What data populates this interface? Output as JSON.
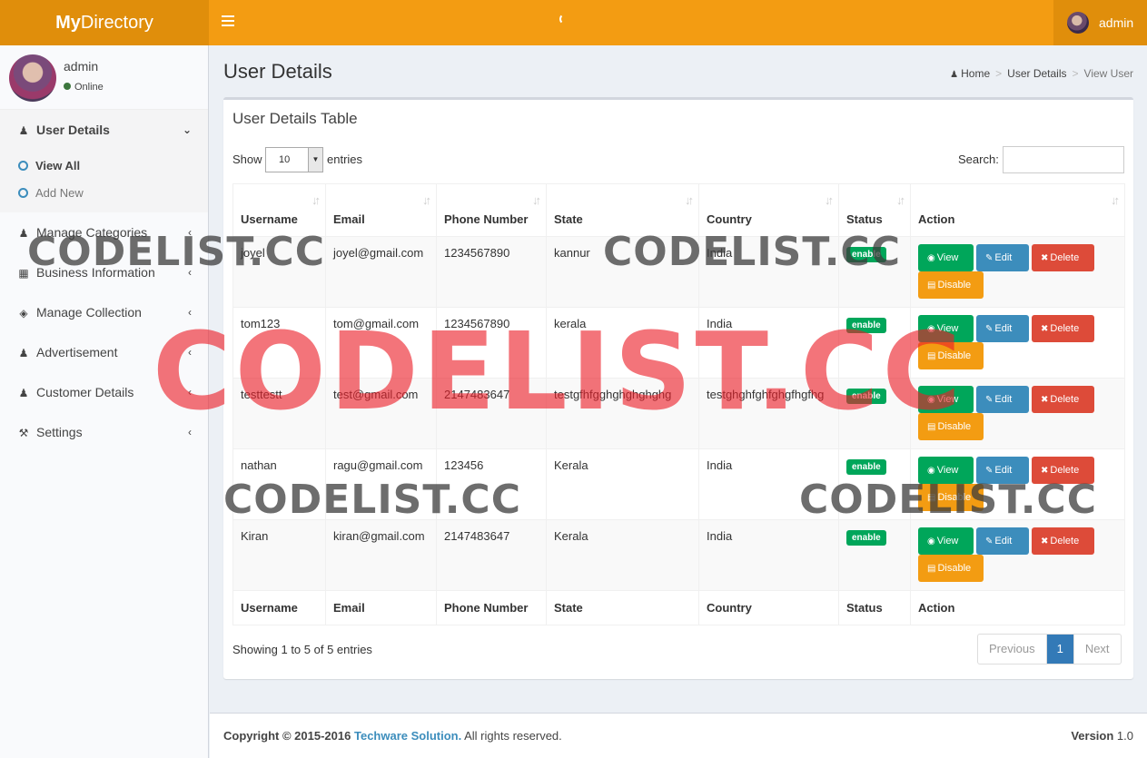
{
  "header": {
    "logo_bold": "My",
    "logo_rest": "Directory",
    "user_name": "admin"
  },
  "sidebar": {
    "user_name": "admin",
    "user_status": "Online",
    "menu": [
      {
        "label": "User Details",
        "icon": "user-icon"
      },
      {
        "label": "Manage Categories",
        "icon": "user-icon"
      },
      {
        "label": "Business Information",
        "icon": "building-icon"
      },
      {
        "label": "Manage Collection",
        "icon": "cube-icon"
      },
      {
        "label": "Advertisement",
        "icon": "user-icon"
      },
      {
        "label": "Customer Details",
        "icon": "users-icon"
      },
      {
        "label": "Settings",
        "icon": "wrench-icon"
      }
    ],
    "submenu": [
      {
        "label": "View All"
      },
      {
        "label": "Add New"
      }
    ]
  },
  "page": {
    "title": "User Details",
    "breadcrumb": [
      "Home",
      "User Details",
      "View User"
    ]
  },
  "box": {
    "title": "User Details Table",
    "show_label": "Show",
    "entries_value": "10",
    "entries_label": "entries",
    "search_label": "Search:",
    "search_value": ""
  },
  "table": {
    "headers": [
      "Username",
      "Email",
      "Phone Number",
      "State",
      "Country",
      "Status",
      "Action"
    ],
    "rows": [
      {
        "username": "joyel",
        "email": "joyel@gmail.com",
        "phone": "1234567890",
        "state": "kannur",
        "country": "India",
        "status": "enable"
      },
      {
        "username": "tom123",
        "email": "tom@gmail.com",
        "phone": "1234567890",
        "state": "kerala",
        "country": "India",
        "status": "enable"
      },
      {
        "username": "testtestt",
        "email": "test@gmail.com",
        "phone": "2147483647",
        "state": "testgfhfgghghghghghg",
        "country": "testghghfghfghgfhgfhg",
        "status": "enable"
      },
      {
        "username": "nathan",
        "email": "ragu@gmail.com",
        "phone": "123456",
        "state": "Kerala",
        "country": "India",
        "status": "enable"
      },
      {
        "username": "Kiran",
        "email": "kiran@gmail.com",
        "phone": "2147483647",
        "state": "Kerala",
        "country": "India",
        "status": "enable"
      }
    ],
    "actions": {
      "view": "View",
      "edit": "Edit",
      "delete": "Delete",
      "disable": "Disable"
    }
  },
  "pagination": {
    "info": "Showing 1 to 5 of 5 entries",
    "previous": "Previous",
    "current": "1",
    "next": "Next"
  },
  "footer": {
    "copyright_prefix": "Copyright © 2015-2016",
    "company": "Techware Solution.",
    "copyright_suffix": "All rights reserved.",
    "version_label": "Version",
    "version_value": "1.0"
  },
  "watermark": {
    "text": "CODELIST.CC"
  }
}
